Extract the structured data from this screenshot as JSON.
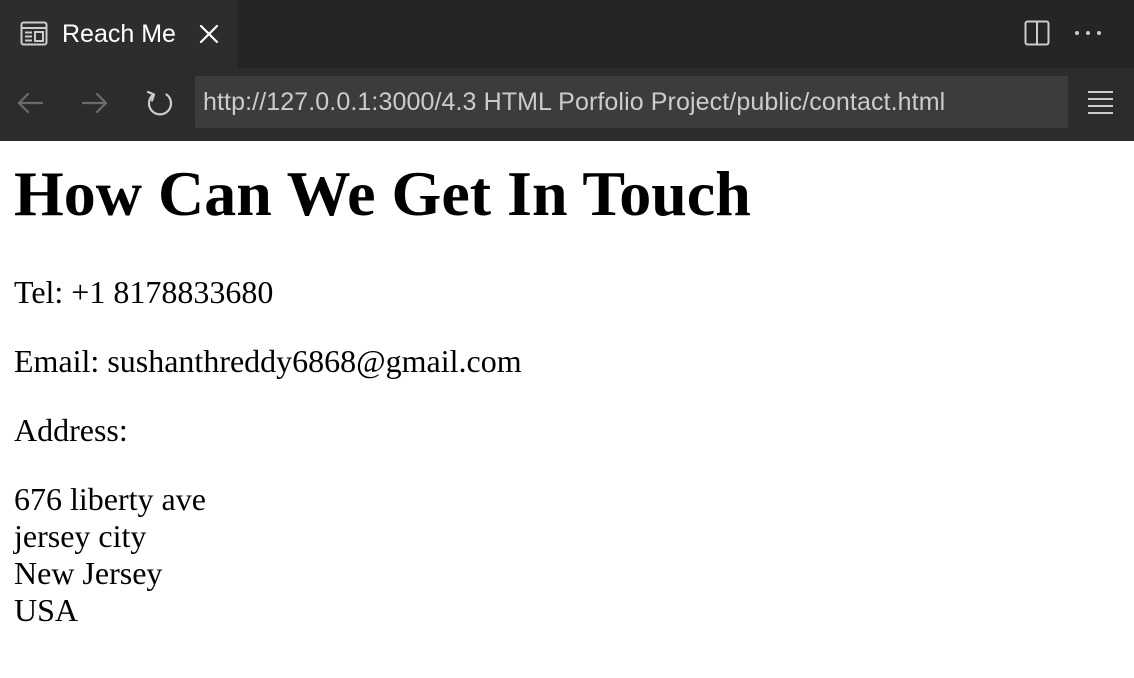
{
  "tab": {
    "title": "Reach Me",
    "icon": "preview-page-icon"
  },
  "toolbar": {
    "url": "http://127.0.0.1:3000/4.3 HTML Porfolio Project/public/contact.html"
  },
  "page": {
    "heading": "How Can We Get In Touch",
    "tel": "Tel: +1 8178833680",
    "email": "Email: sushanthreddy6868@gmail.com",
    "address_label": "Address:",
    "address_lines": [
      "676 liberty ave",
      "jersey city",
      "New Jersey",
      "USA"
    ]
  },
  "colors": {
    "tabbar_bg": "#252526",
    "active_tab_bg": "#2d2d2d",
    "navbar_bg": "#2c2c2c",
    "url_bg": "#3c3c3c",
    "url_text": "#cccccc",
    "page_bg": "#ffffff",
    "page_text": "#000000"
  }
}
